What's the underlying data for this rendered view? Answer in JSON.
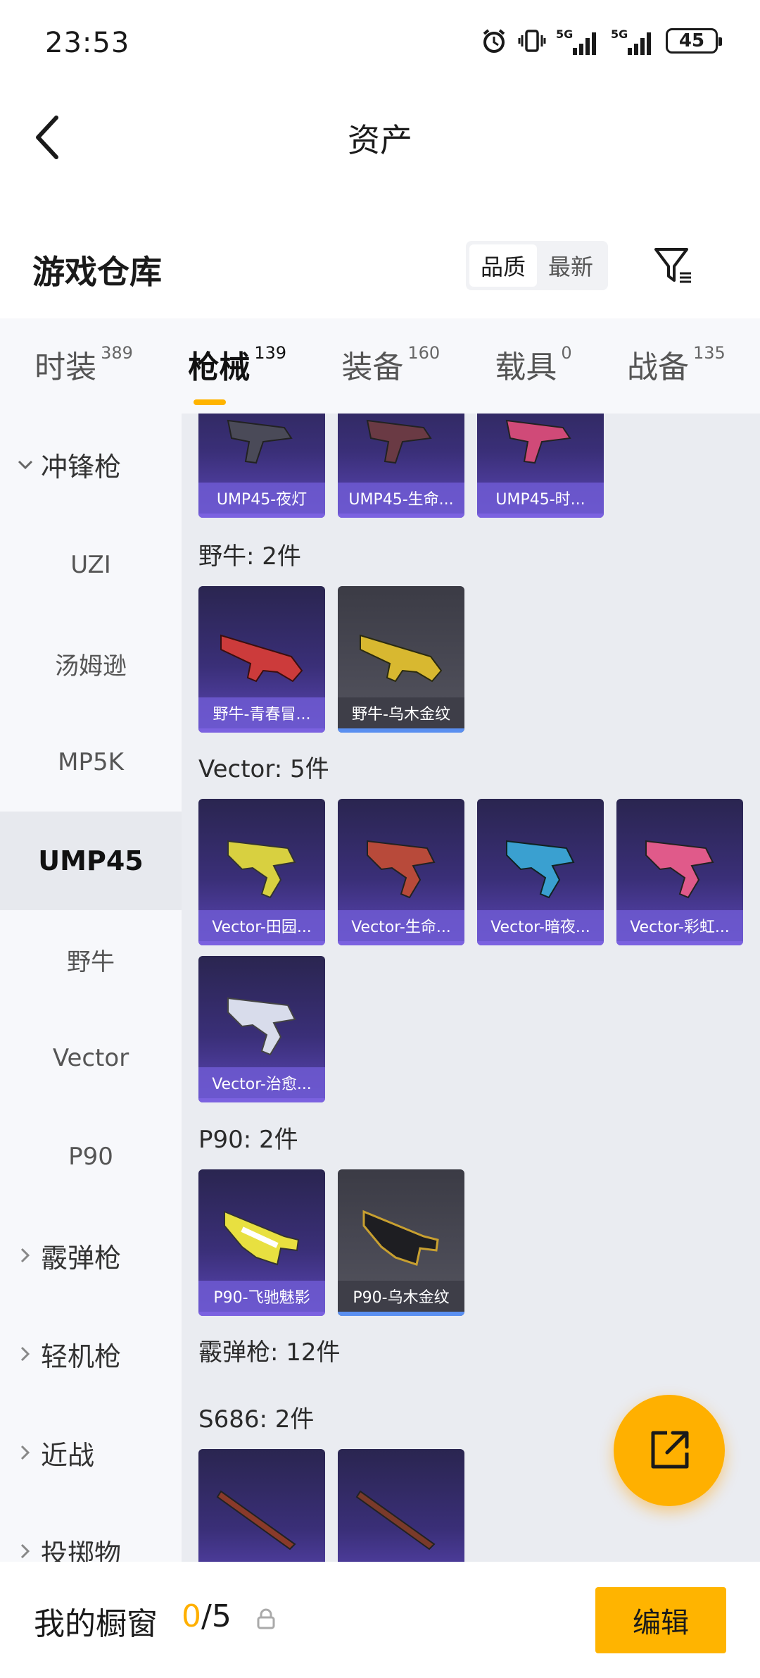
{
  "status_bar": {
    "time": "23:53",
    "network_1": "5G",
    "network_2": "5G",
    "battery": "45"
  },
  "title_bar": {
    "title": "资产"
  },
  "warehouse": {
    "title": "游戏仓库",
    "sort_options": [
      "品质",
      "最新"
    ],
    "active_sort": "品质"
  },
  "tabs": [
    {
      "label": "时装",
      "count": "389"
    },
    {
      "label": "枪械",
      "count": "139"
    },
    {
      "label": "装备",
      "count": "160"
    },
    {
      "label": "载具",
      "count": "0"
    },
    {
      "label": "战备",
      "count": "135"
    }
  ],
  "active_tab": "枪械",
  "sidebar": {
    "items": [
      {
        "label": "冲锋枪",
        "type": "group",
        "expanded": true
      },
      {
        "label": "UZI"
      },
      {
        "label": "汤姆逊"
      },
      {
        "label": "MP5K"
      },
      {
        "label": "UMP45",
        "active": true
      },
      {
        "label": "野牛"
      },
      {
        "label": "Vector"
      },
      {
        "label": "P90"
      },
      {
        "label": "霰弹枪",
        "type": "group",
        "expanded": false
      },
      {
        "label": "轻机枪",
        "type": "group",
        "expanded": false
      },
      {
        "label": "近战",
        "type": "group",
        "expanded": false
      },
      {
        "label": "投掷物",
        "type": "group",
        "expanded": false
      }
    ]
  },
  "content": {
    "ump45_items": [
      "UMP45-夜灯",
      "UMP45-生命...",
      "UMP45-时..."
    ],
    "sections": [
      {
        "title": "野牛: 2件",
        "items": [
          {
            "name": "野牛-青春冒...",
            "color": "#cc3b3b",
            "bg": "purple"
          },
          {
            "name": "野牛-乌木金纹",
            "color": "#d8b830",
            "bg": "gray"
          }
        ]
      },
      {
        "title": "Vector: 5件",
        "items": [
          {
            "name": "Vector-田园...",
            "color": "#d8d040",
            "bg": "purple"
          },
          {
            "name": "Vector-生命...",
            "color": "#b84a3a",
            "bg": "purple"
          },
          {
            "name": "Vector-暗夜...",
            "color": "#3aa0d0",
            "bg": "purple"
          },
          {
            "name": "Vector-彩虹...",
            "color": "#e05a8a",
            "bg": "purple"
          },
          {
            "name": "Vector-治愈...",
            "color": "#d8dceb",
            "bg": "purple"
          }
        ]
      },
      {
        "title": "P90: 2件",
        "items": [
          {
            "name": "P90-飞驰魅影",
            "color": "#e8e040",
            "bg": "purple"
          },
          {
            "name": "P90-乌木金纹",
            "color": "#c8a030",
            "bg": "gray"
          }
        ]
      },
      {
        "title": "霰弹枪: 12件",
        "items": []
      },
      {
        "title": "S686: 2件",
        "items": [
          {
            "name": "",
            "color": "#8a3a2a",
            "bg": "purple"
          },
          {
            "name": "",
            "color": "#7a3a2a",
            "bg": "purple"
          }
        ]
      }
    ]
  },
  "bottom_bar": {
    "title": "我的橱窗",
    "used": "0",
    "total": "/5",
    "edit_label": "编辑"
  },
  "colors": {
    "accent": "#ffb400",
    "card_purple": "#3a2f78",
    "card_gray": "#4a4a55"
  }
}
